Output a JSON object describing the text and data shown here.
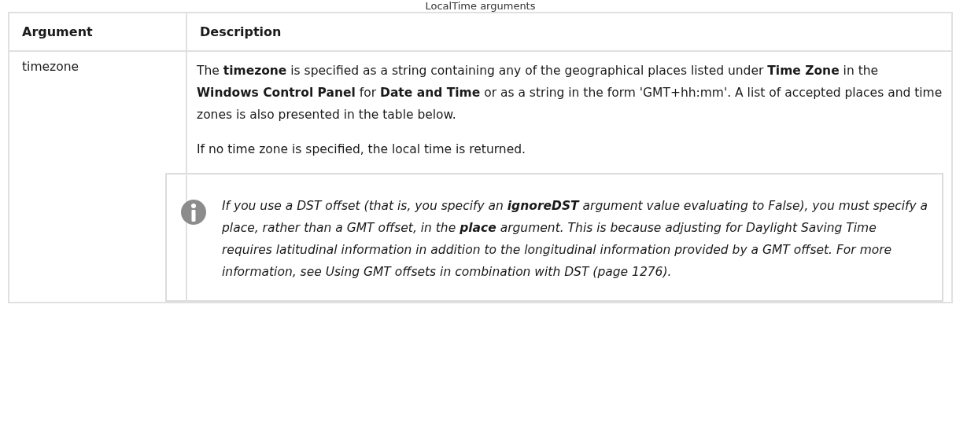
{
  "caption": "LocalTime arguments",
  "table": {
    "columns": [
      "Argument",
      "Description"
    ],
    "rows": [
      {
        "argument": "timezone",
        "paragraphs": [
          "The **timezone** is specified as a string containing any of the geographical places listed under **Time Zone** in the **Windows Control Panel** for **Date and Time** or as a string in the form 'GMT+hh:mm'. A list of accepted places and time zones is also presented in the table below.",
          "If no time zone is specified, the local time is returned."
        ],
        "note": "If you use a DST offset (that is, you specify an **ignoreDST** argument value evaluating to False), you must specify a place, rather than a GMT offset, in the **place** argument. This is because adjusting for Daylight Saving Time requires latitudinal information in addition to the longitudinal information provided by a GMT offset. For more information, see Using GMT offsets in combination with DST (page 1276)."
      }
    ]
  }
}
